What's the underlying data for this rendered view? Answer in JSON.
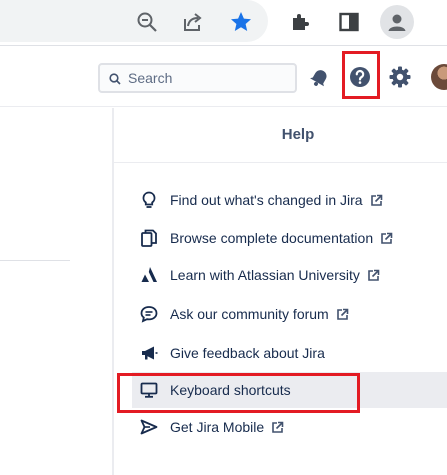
{
  "browser": {
    "icons": [
      "zoom-out-icon",
      "share-icon",
      "bookmark-star-icon",
      "extensions-icon",
      "side-panel-icon",
      "profile-icon"
    ],
    "accent": "#1a73e8"
  },
  "header": {
    "search": {
      "placeholder": "Search",
      "value": ""
    },
    "icons": [
      "notifications-bell-icon",
      "help-icon",
      "settings-gear-icon"
    ],
    "highlight_color": "#e31b23"
  },
  "help_panel": {
    "title": "Help",
    "items": [
      {
        "label": "Find out what's changed in Jira",
        "icon": "lightbulb-icon",
        "external": true,
        "selected": false
      },
      {
        "label": "Browse complete documentation",
        "icon": "documents-icon",
        "external": true,
        "selected": false
      },
      {
        "label": "Learn with Atlassian University",
        "icon": "atlassian-icon",
        "external": true,
        "selected": false
      },
      {
        "label": "Ask our community forum",
        "icon": "chat-icon",
        "external": true,
        "selected": false
      },
      {
        "label": "Give feedback about Jira",
        "icon": "megaphone-icon",
        "external": false,
        "selected": false
      },
      {
        "label": "Keyboard shortcuts",
        "icon": "keyboard-monitor-icon",
        "external": false,
        "selected": true
      },
      {
        "label": "Get Jira Mobile",
        "icon": "send-icon",
        "external": true,
        "selected": false
      }
    ]
  }
}
